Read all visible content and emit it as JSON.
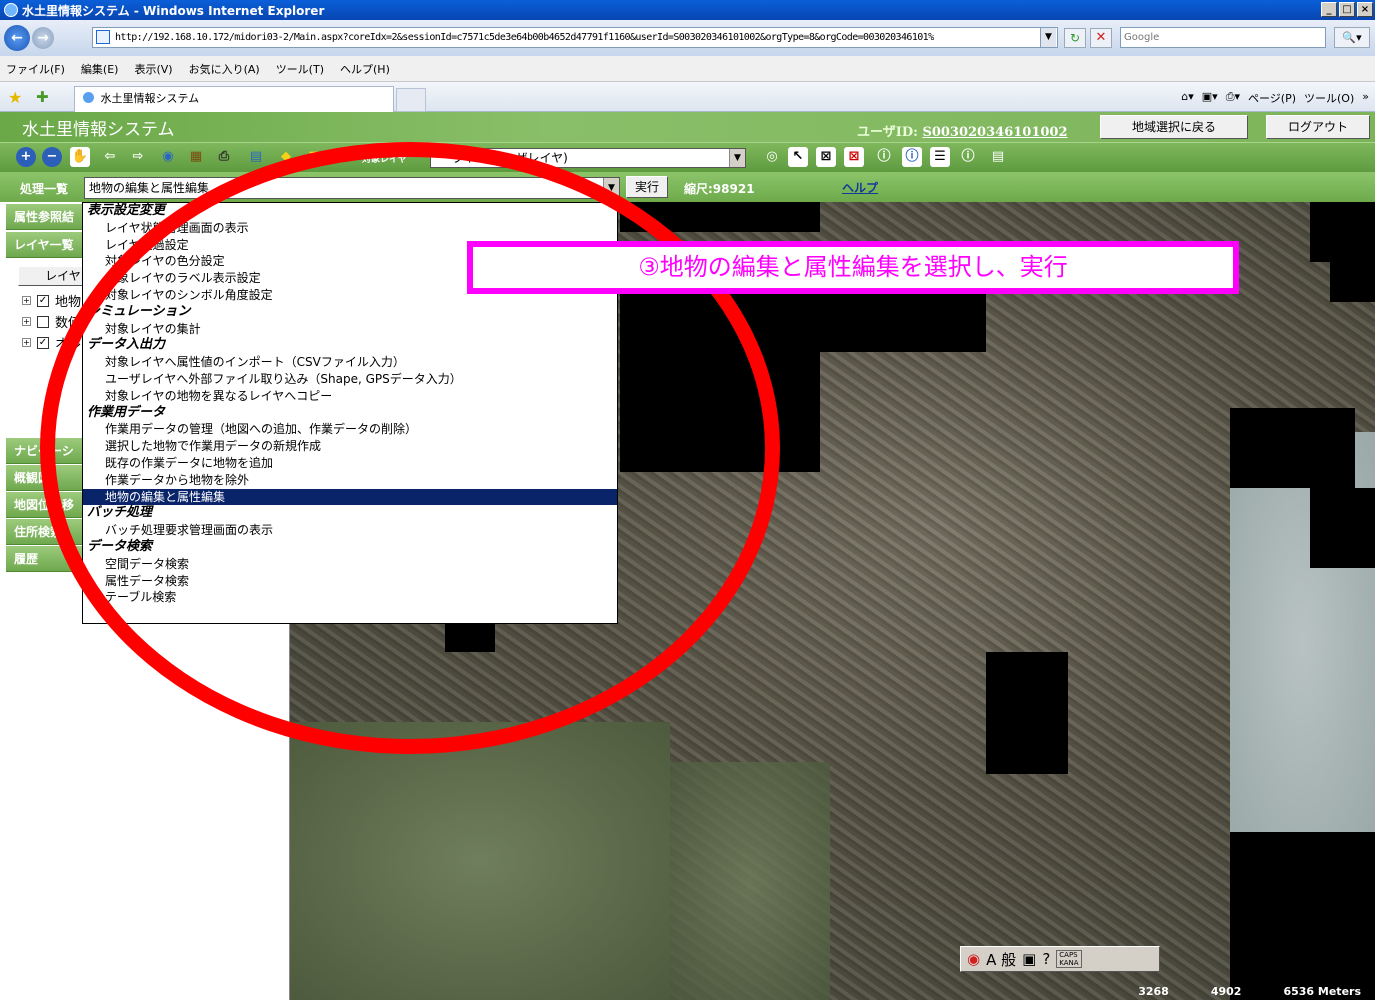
{
  "window": {
    "title": "水土里情報システム - Windows Internet Explorer",
    "url": "http://192.168.10.172/midori03-2/Main.aspx?coreIdx=2&sessionId=c7571c5de3e64b00b4652d47791f1160&userId=S003020346101002&orgType=8&orgCode=003020346101%",
    "search_placeholder": "Google",
    "menu": [
      "ファイル(F)",
      "編集(E)",
      "表示(V)",
      "お気に入り(A)",
      "ツール(T)",
      "ヘルプ(H)"
    ],
    "tab_title": "水土里情報システム",
    "command_bar": {
      "page": "ページ(P)",
      "tools": "ツール(O)"
    }
  },
  "app": {
    "title": "水土里情報システム",
    "user_label": "ユーザID:",
    "user_id": "S003020346101002",
    "back_button": "地域選択に戻る",
    "logout_button": "ログアウト"
  },
  "toolbar": {
    "target_layer_label": "対象レイヤ",
    "target_layer_value": "ライン(ユーザレイヤ)"
  },
  "process": {
    "label": "処理一覧",
    "selected": "地物の編集と属性編集",
    "run_button": "実行",
    "scale": "縮尺:98921",
    "help": "ヘルプ"
  },
  "left_panel": {
    "sections": [
      "属性参照結",
      "レイヤ一覧",
      "ナビゲーシ",
      "概観図",
      "地図位置移",
      "住所検索",
      "履歴"
    ],
    "layer_button": "レイヤ",
    "tree": [
      {
        "label": "地物",
        "checked": true
      },
      {
        "label": "数値",
        "checked": false
      },
      {
        "label": "オル",
        "checked": true
      }
    ]
  },
  "dropdown": [
    {
      "type": "group",
      "label": "表示設定変更"
    },
    {
      "type": "item",
      "label": "レイヤ状態管理画面の表示"
    },
    {
      "type": "item",
      "label": "レイヤ透過設定"
    },
    {
      "type": "item",
      "label": "対象レイヤの色分設定"
    },
    {
      "type": "item",
      "label": "対象レイヤのラベル表示設定"
    },
    {
      "type": "item",
      "label": "対象レイヤのシンボル角度設定"
    },
    {
      "type": "group",
      "label": "シミュレーション"
    },
    {
      "type": "item",
      "label": "対象レイヤの集計"
    },
    {
      "type": "group",
      "label": "データ入出力"
    },
    {
      "type": "item",
      "label": "対象レイヤへ属性値のインポート（CSVファイル入力）"
    },
    {
      "type": "item",
      "label": "ユーザレイヤへ外部ファイル取り込み（Shape, GPSデータ入力）"
    },
    {
      "type": "item",
      "label": "対象レイヤの地物を異なるレイヤへコピー"
    },
    {
      "type": "group",
      "label": "作業用データ"
    },
    {
      "type": "item",
      "label": "作業用データの管理（地図への追加、作業データの削除）"
    },
    {
      "type": "item",
      "label": "選択した地物で作業用データの新規作成"
    },
    {
      "type": "item",
      "label": "既存の作業データに地物を追加"
    },
    {
      "type": "item",
      "label": "作業データから地物を除外"
    },
    {
      "type": "item",
      "label": "地物の編集と属性編集",
      "selected": true
    },
    {
      "type": "group",
      "label": "バッチ処理"
    },
    {
      "type": "item",
      "label": "バッチ処理要求管理画面の表示"
    },
    {
      "type": "group",
      "label": "データ検索"
    },
    {
      "type": "item",
      "label": "空間データ検索"
    },
    {
      "type": "item",
      "label": "属性データ検索"
    },
    {
      "type": "item",
      "label": "テーブル検索"
    }
  ],
  "annotation": {
    "callout": "③地物の編集と属性編集を選択し、実行",
    "callout_color": "#ff00ff",
    "ellipse_color": "#ff0000"
  },
  "map": {
    "scale_labels": [
      "3268",
      "4902",
      "6536 Meters"
    ]
  },
  "ime": {
    "mode": "A 般",
    "caps": "CAPS",
    "kana": "KANA"
  }
}
